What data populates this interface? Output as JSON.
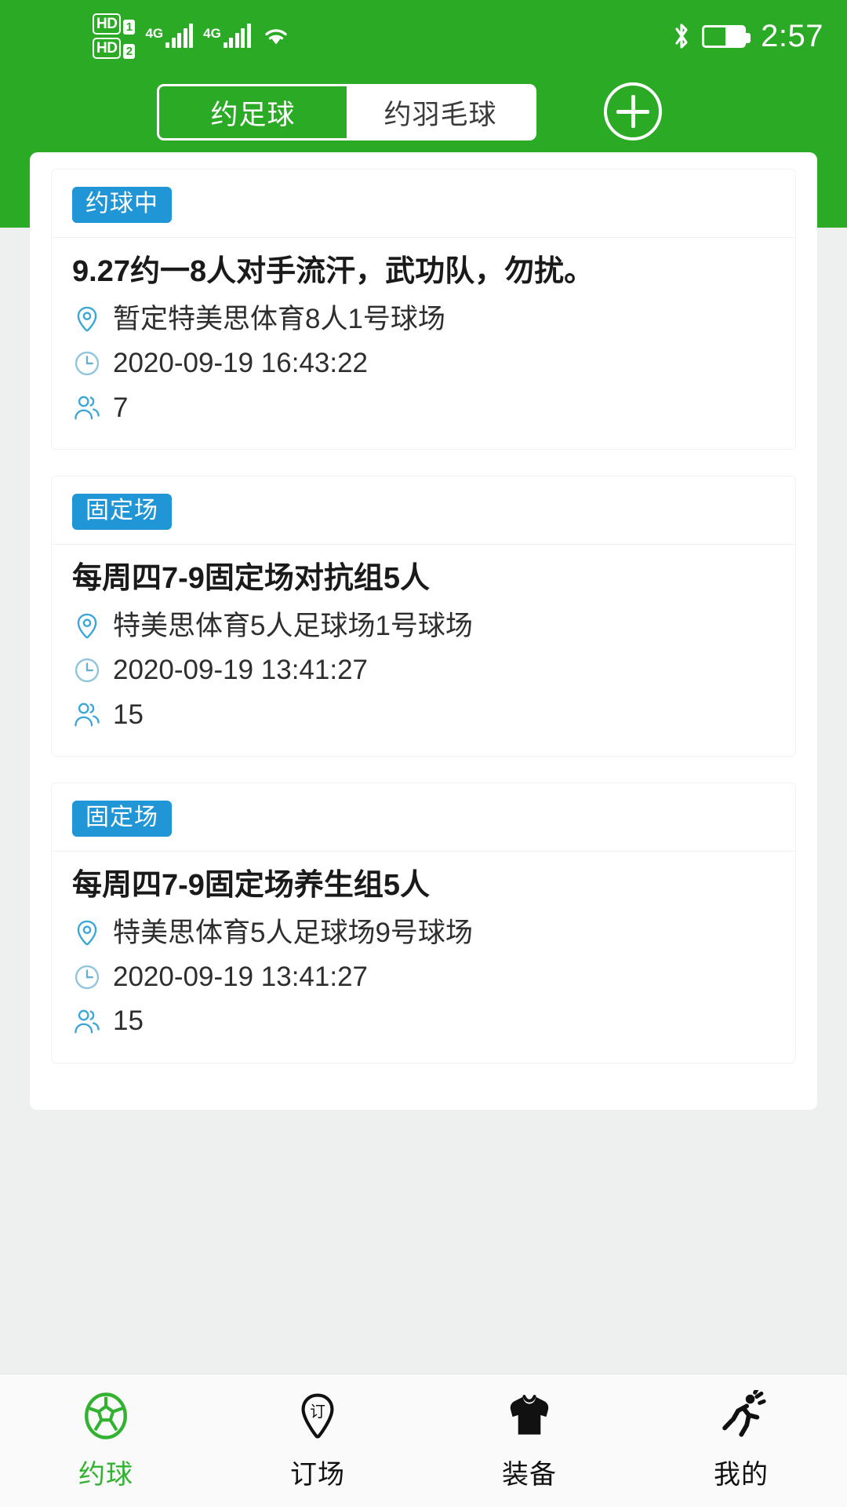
{
  "statusbar": {
    "hd1_label": "HD",
    "hd1_num": "1",
    "hd2_label": "HD",
    "hd2_num": "2",
    "net1": "4G",
    "net2": "4G",
    "time": "2:57",
    "icons": [
      "hd-volte-icon",
      "signal-bars-icon",
      "wifi-icon",
      "bluetooth-icon",
      "battery-icon"
    ]
  },
  "header": {
    "tabs": [
      {
        "label": "约足球",
        "active": true
      },
      {
        "label": "约羽毛球",
        "active": false
      }
    ],
    "add_button": "add-icon",
    "accent_green": "#2bab25"
  },
  "cards": [
    {
      "badge": "约球中",
      "badge_color": "#2196d6",
      "title": "9.27约一8人对手流汗，武功队，勿扰。",
      "location": "暂定特美思体育8人1号球场",
      "time": "2020-09-19 16:43:22",
      "people": "7"
    },
    {
      "badge": "固定场",
      "badge_color": "#2196d6",
      "title": "每周四7-9固定场对抗组5人",
      "location": "特美思体育5人足球场1号球场",
      "time": "2020-09-19 13:41:27",
      "people": "15"
    },
    {
      "badge": "固定场",
      "badge_color": "#2196d6",
      "title": "每周四7-9固定场养生组5人",
      "location": "特美思体育5人足球场9号球场",
      "time": "2020-09-19 13:41:27",
      "people": "15"
    }
  ],
  "tabbar": {
    "active_color": "#33b231",
    "items": [
      {
        "label": "约球",
        "icon": "soccer-ball-icon",
        "active": true
      },
      {
        "label": "订场",
        "icon": "booking-pin-icon",
        "active": false
      },
      {
        "label": "装备",
        "icon": "jersey-icon",
        "active": false
      },
      {
        "label": "我的",
        "icon": "runner-icon",
        "active": false
      }
    ]
  }
}
